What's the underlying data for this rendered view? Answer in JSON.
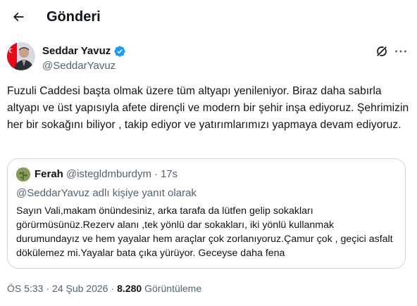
{
  "header": {
    "title": "Gönderi"
  },
  "author": {
    "name": "Seddar Yavuz",
    "handle": "@SeddarYavuz"
  },
  "tweet": {
    "text": "Fuzuli Caddesi başta olmak üzere tüm altyapı yenileniyor. Biraz daha sabırla altyapı ve üst yapısıyla afete dirençli ve modern bir şehir inşa ediyoruz. Şehrimizin her bir sokağını biliyor , takip ediyor ve yatırımlarımızı yapmaya devam ediyoruz."
  },
  "quote": {
    "name": "Ferah",
    "handle": "@istegldmburdym",
    "separator": "·",
    "time": "17s",
    "reply_to": "@SeddarYavuz adlı kişiye yanıt olarak",
    "text": "Sayın Vali,makam önündesiniz, arka tarafa da lütfen gelip sokakları görürmüsünüz.Rezerv alanı ,tek yönlü dar sokakları, iki yönlü kullanmak durumundayız ve hem yayalar hem araçlar çok zorlanıyoruz.Çamur çok , geçici asfalt dökülemez mi.Yayalar bata çıka yürüyor. Geceyse daha fena"
  },
  "meta": {
    "time": "ÖS 5:33",
    "separator": "·",
    "date": "24 Şub 2026",
    "views_count": "8.280",
    "views_label": "Görüntüleme"
  },
  "icons": {
    "back": "arrow-left-icon",
    "verified": "verified-badge-icon",
    "grok": "grok-icon",
    "more": "more-horizontal-icon"
  },
  "colors": {
    "text_primary": "#0f1419",
    "text_secondary": "#536471",
    "verified_blue": "#1d9bf0",
    "border": "#cfd9de"
  }
}
